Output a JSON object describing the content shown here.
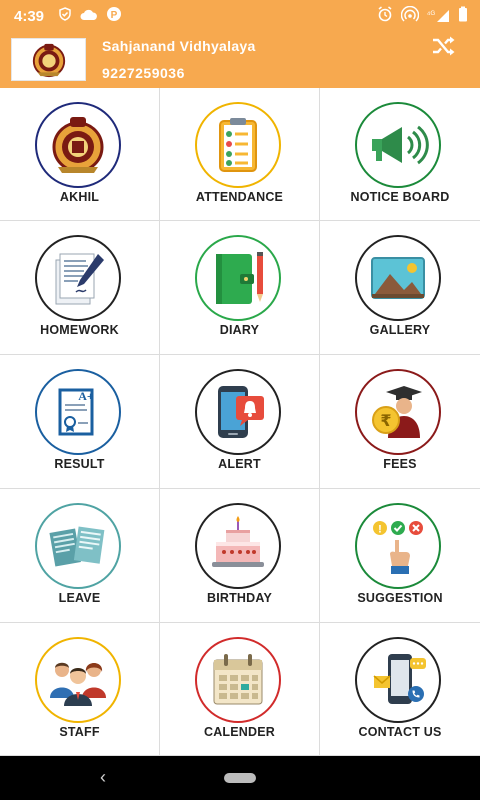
{
  "status_bar": {
    "time": "4:39",
    "icons": [
      "shield-check-icon",
      "cloud-icon",
      "p-badge-icon",
      "alarm-icon",
      "hotspot-icon",
      "signal-icon",
      "battery-icon"
    ],
    "signal_label": "⁴ᴳ"
  },
  "header": {
    "school_name": "Sahjanand Vidhyalaya",
    "phone": "9227259036",
    "background_color": "#f7a94f",
    "switch_icon": "shuffle-icon"
  },
  "grid": {
    "items": [
      {
        "label": "AKHIL",
        "icon": "school-emblem-icon",
        "ring": "#1f2a7a"
      },
      {
        "label": "ATTENDANCE",
        "icon": "checklist-icon",
        "ring": "#f0b400"
      },
      {
        "label": "NOTICE BOARD",
        "icon": "megaphone-icon",
        "ring": "#1b8a3a"
      },
      {
        "label": "HOMEWORK",
        "icon": "document-pen-icon",
        "ring": "#222222"
      },
      {
        "label": "DIARY",
        "icon": "diary-icon",
        "ring": "#2aa84a"
      },
      {
        "label": "GALLERY",
        "icon": "picture-icon",
        "ring": "#222222"
      },
      {
        "label": "RESULT",
        "icon": "certificate-icon",
        "ring": "#1a5fa0"
      },
      {
        "label": "ALERT",
        "icon": "phone-alert-icon",
        "ring": "#222222"
      },
      {
        "label": "FEES",
        "icon": "graduate-rupee-icon",
        "ring": "#8b1a1a"
      },
      {
        "label": "LEAVE",
        "icon": "documents-icon",
        "ring": "#4fa3a3"
      },
      {
        "label": "BIRTHDAY",
        "icon": "cake-icon",
        "ring": "#222222"
      },
      {
        "label": "SUGGESTION",
        "icon": "hand-choice-icon",
        "ring": "#1b8a3a"
      },
      {
        "label": "STAFF",
        "icon": "people-group-icon",
        "ring": "#f0b400"
      },
      {
        "label": "CALENDER",
        "icon": "calendar-icon",
        "ring": "#d12b2b"
      },
      {
        "label": "CONTACT US",
        "icon": "phone-contact-icon",
        "ring": "#222222"
      }
    ]
  },
  "nav_bar": {
    "back_label": "‹"
  }
}
